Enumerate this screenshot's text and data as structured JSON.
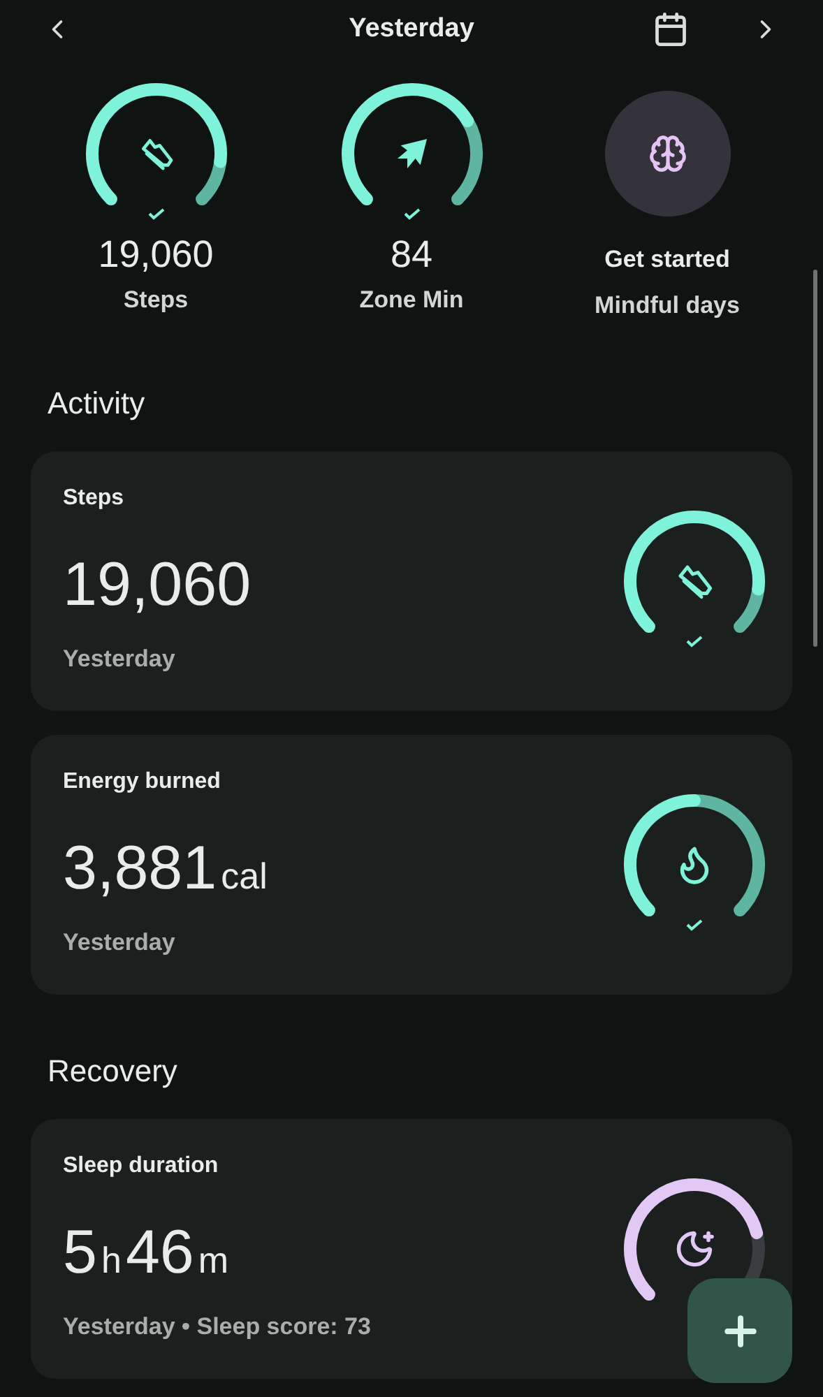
{
  "header": {
    "title": "Yesterday"
  },
  "summary": [
    {
      "kind": "ring",
      "goal_met": true,
      "value": "19,060",
      "label": "Steps"
    },
    {
      "kind": "ring",
      "goal_met": true,
      "value": "84",
      "label": "Zone Min"
    },
    {
      "kind": "disc",
      "value": "Get started",
      "label": "Mindful days"
    }
  ],
  "sections": [
    {
      "title": "Activity",
      "cards": [
        {
          "title": "Steps",
          "value_parts": [
            {
              "text": "19,060",
              "kind": "num"
            }
          ],
          "subtitle": "Yesterday",
          "goal_met": true
        },
        {
          "title": "Energy burned",
          "value_parts": [
            {
              "text": "3,881",
              "kind": "num"
            },
            {
              "text": "cal",
              "kind": "unit"
            }
          ],
          "subtitle": "Yesterday",
          "goal_met": true
        }
      ]
    },
    {
      "title": "Recovery",
      "cards": [
        {
          "title": "Sleep duration",
          "value_parts": [
            {
              "text": "5",
              "kind": "num"
            },
            {
              "text": "h",
              "kind": "unit"
            },
            {
              "text": "46",
              "kind": "num"
            },
            {
              "text": "m",
              "kind": "unit"
            }
          ],
          "subtitle": "Yesterday • Sleep score: 73",
          "goal_met": false
        }
      ]
    }
  ]
}
